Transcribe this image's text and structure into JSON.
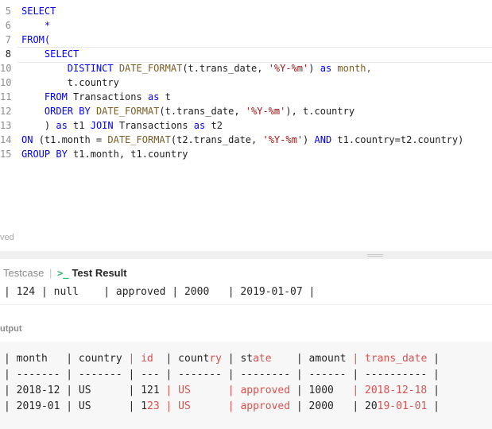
{
  "editor": {
    "lines": [
      {
        "num": "5",
        "tokens": [
          {
            "t": "SELECT",
            "c": "kw"
          }
        ]
      },
      {
        "num": "6",
        "tokens": [
          {
            "t": "    *",
            "c": "kw"
          }
        ]
      },
      {
        "num": "7",
        "tokens": [
          {
            "t": "FROM(",
            "c": "kw"
          }
        ]
      },
      {
        "num": "8",
        "tokens": [
          {
            "t": "    SELECT",
            "c": "kw"
          }
        ]
      },
      {
        "num": "10",
        "tokens": [
          {
            "t": "        DISTINCT ",
            "c": "kw"
          },
          {
            "t": "DATE_FORMAT",
            "c": "fn"
          },
          {
            "t": "(t.trans_date, ",
            "c": "plain"
          },
          {
            "t": "'%Y-%m'",
            "c": "str"
          },
          {
            "t": ") ",
            "c": "plain"
          },
          {
            "t": "as ",
            "c": "kw"
          },
          {
            "t": "month,",
            "c": "fn"
          }
        ]
      },
      {
        "num": "10",
        "tokens": [
          {
            "t": "        t.country",
            "c": "plain"
          }
        ]
      },
      {
        "num": "11",
        "tokens": [
          {
            "t": "    ",
            "c": "plain"
          },
          {
            "t": "FROM ",
            "c": "kw"
          },
          {
            "t": "Transactions ",
            "c": "plain"
          },
          {
            "t": "as ",
            "c": "kw"
          },
          {
            "t": "t",
            "c": "plain"
          }
        ]
      },
      {
        "num": "12",
        "tokens": [
          {
            "t": "    ",
            "c": "plain"
          },
          {
            "t": "ORDER BY ",
            "c": "kw"
          },
          {
            "t": "DATE_FORMAT",
            "c": "fn"
          },
          {
            "t": "(t.trans_date, ",
            "c": "plain"
          },
          {
            "t": "'%Y-%m'",
            "c": "str"
          },
          {
            "t": "), t.country",
            "c": "plain"
          }
        ]
      },
      {
        "num": "13",
        "tokens": [
          {
            "t": "    ) ",
            "c": "plain"
          },
          {
            "t": "as ",
            "c": "kw"
          },
          {
            "t": "t1 ",
            "c": "plain"
          },
          {
            "t": "JOIN ",
            "c": "kw"
          },
          {
            "t": "Transactions ",
            "c": "plain"
          },
          {
            "t": "as ",
            "c": "kw"
          },
          {
            "t": "t2",
            "c": "plain"
          }
        ]
      },
      {
        "num": "14",
        "tokens": [
          {
            "t": "ON ",
            "c": "kw"
          },
          {
            "t": "(t1.month = ",
            "c": "plain"
          },
          {
            "t": "DATE_FORMAT",
            "c": "fn"
          },
          {
            "t": "(t2.trans_date, ",
            "c": "plain"
          },
          {
            "t": "'%Y-%m'",
            "c": "str"
          },
          {
            "t": ") ",
            "c": "plain"
          },
          {
            "t": "AND ",
            "c": "kw"
          },
          {
            "t": "t1.country=t2.country)",
            "c": "plain"
          }
        ]
      },
      {
        "num": "15",
        "tokens": [
          {
            "t": "GROUP BY ",
            "c": "kw"
          },
          {
            "t": "t1.month, t1.country",
            "c": "plain"
          }
        ]
      }
    ]
  },
  "saved_text": "ved",
  "tabs": {
    "testcase": "Testcase",
    "separator": "|",
    "result": "Test Result",
    "result_icon": "terminal-icon"
  },
  "input_row": "| 124 | null    | approved | 2000   | 2019-01-07 |",
  "output_label": "utput",
  "output_rows": [
    [
      {
        "t": "| month   | country ",
        "d": false
      },
      {
        "t": "| id  ",
        "d": true
      },
      {
        "t": "| count",
        "d": false
      },
      {
        "t": "ry",
        "d": true
      },
      {
        "t": " | st",
        "d": false
      },
      {
        "t": "ate    ",
        "d": true
      },
      {
        "t": "| amount ",
        "d": false
      },
      {
        "t": "| trans_date",
        "d": true
      },
      {
        "t": " |",
        "d": false
      }
    ],
    [
      {
        "t": "| ------- | ------- ",
        "d": false
      },
      {
        "t": "| --- ",
        "d": false
      },
      {
        "t": "| ------- | -------- | ------ | ---------- |",
        "d": false
      }
    ],
    [
      {
        "t": "| 2018-12 | US      ",
        "d": false
      },
      {
        "t": "| 121 ",
        "d": false
      },
      {
        "t": "| US      ",
        "d": true
      },
      {
        "t": "| approved ",
        "d": true
      },
      {
        "t": "| 1000   ",
        "d": false
      },
      {
        "t": "| 2018-12-18",
        "d": true
      },
      {
        "t": " |",
        "d": false
      }
    ],
    [
      {
        "t": "| 2019-01 | US      ",
        "d": false
      },
      {
        "t": "| 1",
        "d": false
      },
      {
        "t": "23 ",
        "d": true
      },
      {
        "t": "| US      ",
        "d": true
      },
      {
        "t": "| approved ",
        "d": true
      },
      {
        "t": "| 2000   ",
        "d": false
      },
      {
        "t": "| 20",
        "d": false
      },
      {
        "t": "19-01-01",
        "d": true
      },
      {
        "t": " |",
        "d": false
      }
    ]
  ]
}
